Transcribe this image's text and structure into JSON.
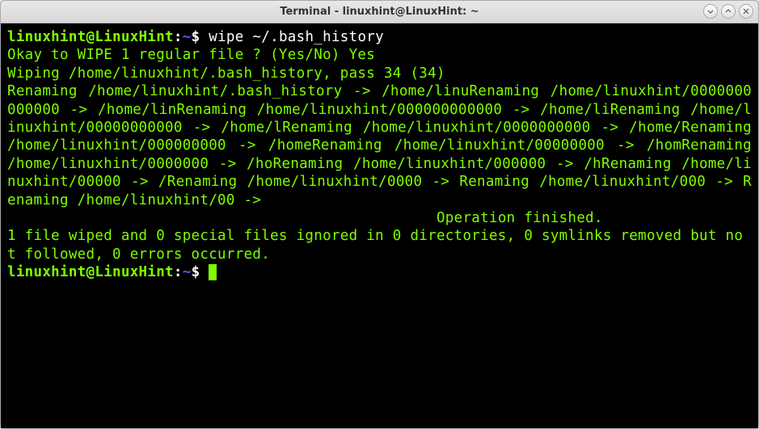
{
  "window": {
    "title": "Terminal - linuxhint@LinuxHint: ~"
  },
  "prompt": {
    "userhost": "linuxhint@LinuxHint",
    "sep": ":",
    "path": "~",
    "symbol": "$"
  },
  "command1": "wipe ~/.bash_history",
  "output": {
    "line1": "Okay to WIPE 1 regular file ? (Yes/No) Yes",
    "line2": "Wiping /home/linuxhint/.bash_history, pass 34 (34)",
    "block": "Renaming /home/linuxhint/.bash_history -> /home/linuRenaming /home/linuxhint/0000000000000 -> /home/linRenaming /home/linuxhint/000000000000 -> /home/liRenaming /home/linuxhint/00000000000 -> /home/lRenaming /home/linuxhint/0000000000 -> /home/Renaming /home/linuxhint/000000000 -> /homeRenaming /home/linuxhint/00000000 -> /homRenaming /home/linuxhint/0000000 -> /hoRenaming /home/linuxhint/000000 -> /hRenaming /home/linuxhint/00000 -> /Renaming /home/linuxhint/0000 -> Renaming /home/linuxhint/000 -> Renaming /home/linuxhint/00 ->",
    "finished": "                                                 Operation finished.",
    "summary": "1 file wiped and 0 special files ignored in 0 directories, 0 symlinks removed but not followed, 0 errors occurred."
  }
}
